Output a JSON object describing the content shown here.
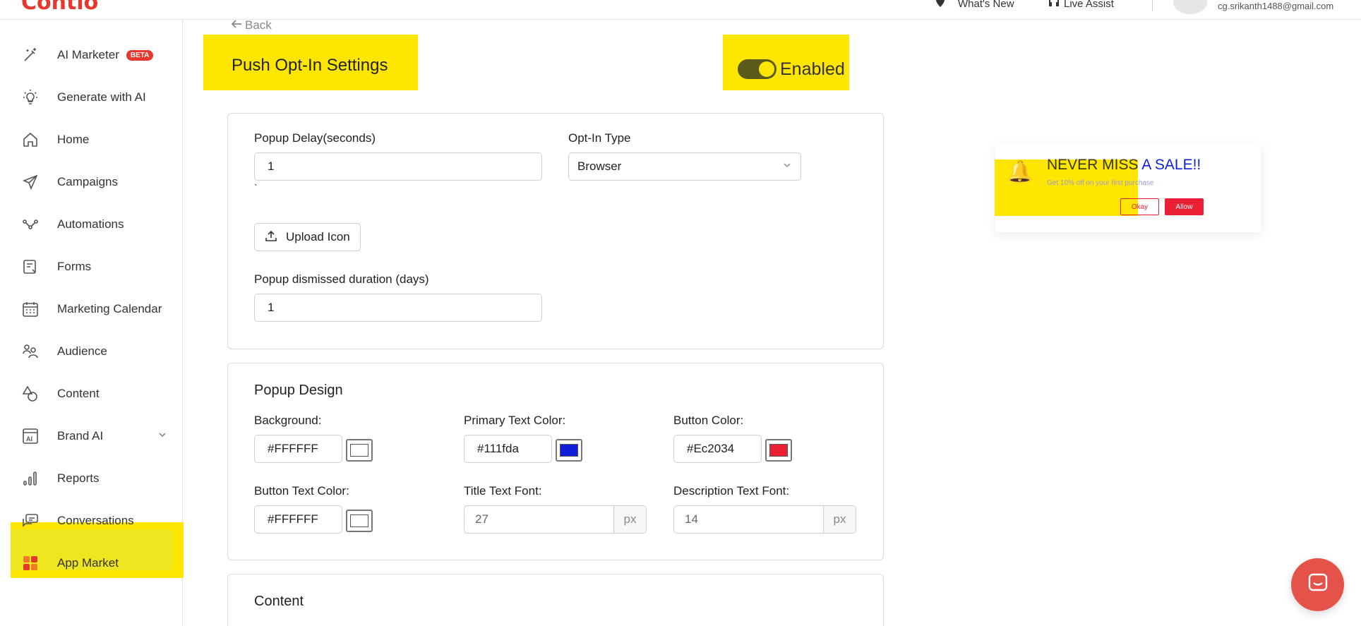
{
  "header": {
    "logo": "Contlo",
    "whats_new": "What's New",
    "live_assist": "Live Assist",
    "email": "cg.srikanth1488@gmail.com"
  },
  "sidebar": {
    "items": [
      {
        "label": "AI Marketer",
        "badge": "BETA",
        "icon": "magic-wand-icon"
      },
      {
        "label": "Generate with AI",
        "icon": "lightbulb-icon"
      },
      {
        "label": "Home",
        "icon": "home-icon"
      },
      {
        "label": "Campaigns",
        "icon": "paper-plane-icon"
      },
      {
        "label": "Automations",
        "icon": "flow-icon"
      },
      {
        "label": "Forms",
        "icon": "form-icon"
      },
      {
        "label": "Marketing Calendar",
        "icon": "calendar-icon"
      },
      {
        "label": "Audience",
        "icon": "people-icon"
      },
      {
        "label": "Content",
        "icon": "shapes-icon"
      },
      {
        "label": "Brand AI",
        "icon": "ai-box-icon"
      },
      {
        "label": "Reports",
        "icon": "bar-chart-icon"
      },
      {
        "label": "Conversations",
        "icon": "chat-icon"
      },
      {
        "label": "App Market",
        "icon": "apps-grid-icon",
        "active": true
      }
    ]
  },
  "page": {
    "back": "Back",
    "title": "Push Opt-In Settings",
    "toggle_label": "Enabled",
    "toggle_on": true
  },
  "settings": {
    "popup_delay_label": "Popup Delay(seconds)",
    "popup_delay_value": "1",
    "tick_mark": "`",
    "optin_type_label": "Opt-In Type",
    "optin_type_value": "Browser",
    "upload_icon_label": "Upload Icon",
    "dismissed_label": "Popup dismissed duration (days)",
    "dismissed_value": "1"
  },
  "design": {
    "title": "Popup Design",
    "background_label": "Background:",
    "background_value": "#FFFFFF",
    "primary_text_label": "Primary Text Color:",
    "primary_text_value": "#111fda",
    "button_color_label": "Button Color:",
    "button_color_value": "#Ec2034",
    "button_text_label": "Button Text Color:",
    "button_text_value": "#FFFFFF",
    "title_font_label": "Title Text Font:",
    "title_font_value": "27",
    "desc_font_label": "Description Text Font:",
    "desc_font_value": "14",
    "unit": "px"
  },
  "content_section": {
    "title": "Content"
  },
  "preview": {
    "title_part1": "NEVER MISS",
    "title_part2": " A SALE!!",
    "description": "Get 10% off on your first purchase",
    "okay": "Okay",
    "allow": "Allow"
  },
  "colors": {
    "accent": "#e8372c",
    "highlight": "#ffe600",
    "primary_text": "#111fda",
    "button": "#ec2034"
  }
}
